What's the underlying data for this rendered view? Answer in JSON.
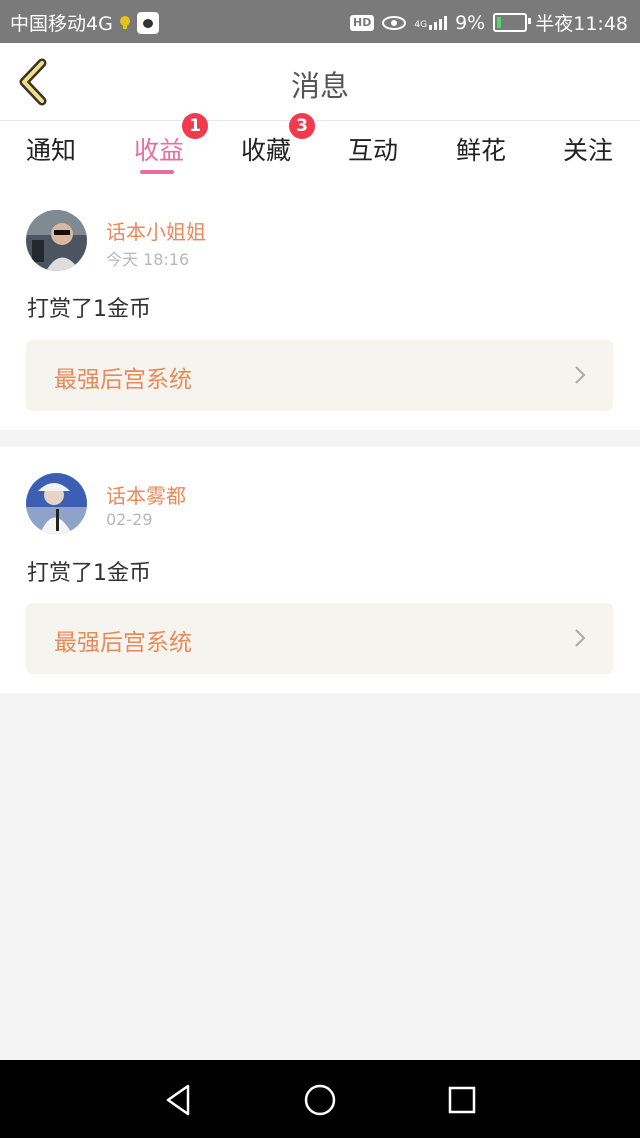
{
  "status_bar": {
    "carrier": "中国移动4G",
    "hd_label": "HD",
    "network": "4G",
    "battery_percent": "9%",
    "time": "半夜11:48"
  },
  "header": {
    "title": "消息"
  },
  "tabs": [
    {
      "label": "通知",
      "badge": ""
    },
    {
      "label": "收益",
      "badge": "1"
    },
    {
      "label": "收藏",
      "badge": "3"
    },
    {
      "label": "互动",
      "badge": ""
    },
    {
      "label": "鲜花",
      "badge": ""
    },
    {
      "label": "关注",
      "badge": ""
    }
  ],
  "active_tab": "收益",
  "messages": [
    {
      "username": "话本小姐姐",
      "time": "今天 18:16",
      "content": "打赏了1金币",
      "book_title": "最强后宫系统"
    },
    {
      "username": "话本雾都",
      "time": "02-29",
      "content": "打赏了1金币",
      "book_title": "最强后宫系统"
    }
  ],
  "colors": {
    "accent": "#ea6da0",
    "name_color": "#e88a5a",
    "badge": "#f23a4d"
  }
}
